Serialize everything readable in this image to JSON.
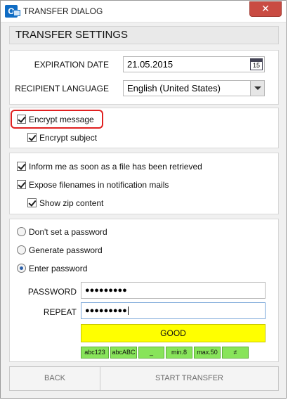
{
  "window": {
    "title": "TRANSFER DIALOG",
    "app_icon_letter": "O",
    "close_glyph": "✕"
  },
  "heading": "TRANSFER SETTINGS",
  "settings": {
    "expiration_label": "EXPIRATION DATE",
    "expiration_value": "21.05.2015",
    "calendar_day": "15",
    "language_label": "RECIPIENT LANGUAGE",
    "language_value": "English (United States)"
  },
  "encryption": {
    "encrypt_message": {
      "label": "Encrypt message",
      "checked": true
    },
    "encrypt_subject": {
      "label": "Encrypt subject",
      "checked": true
    }
  },
  "notifications": {
    "inform": {
      "label": "Inform me as soon as a file has been retrieved",
      "checked": true
    },
    "expose": {
      "label": "Expose filenames in notification mails",
      "checked": true
    },
    "zip": {
      "label": "Show zip content",
      "checked": true
    }
  },
  "password": {
    "options": [
      {
        "label": "Don't set a password",
        "selected": false
      },
      {
        "label": "Generate password",
        "selected": false
      },
      {
        "label": "Enter password",
        "selected": true
      }
    ],
    "password_label": "PASSWORD",
    "password_value": "●●●●●●●●●",
    "repeat_label": "REPEAT",
    "repeat_value": "●●●●●●●●●",
    "strength": "GOOD",
    "strength_color": "#ffff00",
    "rules": [
      "abc123",
      "abcABC",
      "_",
      "min.8",
      "max.50",
      "≠"
    ],
    "rule_color": "#88e45a"
  },
  "footer": {
    "back_label": "BACK",
    "start_label": "START TRANSFER"
  },
  "icons": [
    "outlook-app-icon",
    "close-icon",
    "calendar-icon",
    "chevron-down-icon"
  ]
}
